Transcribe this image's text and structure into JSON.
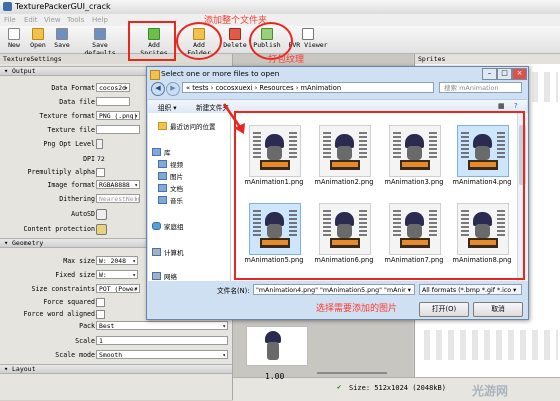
{
  "window": {
    "title": "TexturePackerGUI_crack"
  },
  "menu": [
    "File",
    "Edit",
    "View",
    "Tools",
    "Help"
  ],
  "toolbar": {
    "buttons": [
      "New",
      "Open",
      "Save",
      "Save defaults",
      "Add Sprites",
      "Add Folder",
      "Delete",
      "Publish",
      "PVR Viewer"
    ]
  },
  "settings": {
    "panel_title": "TextureSettings",
    "output_section": "Output",
    "data_format_label": "Data Format",
    "data_format_value": "cocos2d",
    "data_file_label": "Data file",
    "texture_format_label": "Texture format",
    "texture_format_value": "PNG (.png)",
    "texture_file_label": "Texture file",
    "png_opt_label": "Png Opt Level",
    "dpi_label": "DPI",
    "dpi_value": "72",
    "premultiply_label": "Premultiply alpha",
    "image_format_label": "Image format",
    "image_format_value": "RGBA8888",
    "dithering_label": "Dithering",
    "dithering_value": "NearestNeigh",
    "autosd_label": "AutoSD",
    "content_protection_label": "Content protection",
    "geometry_section": "Geometry",
    "max_size_label": "Max size",
    "max_size_value": "W: 2048",
    "fixed_size_label": "Fixed size",
    "fixed_size_value": "W:",
    "size_constraints_label": "Size constraints",
    "size_constraints_value": "POT (Power",
    "force_squared_label": "Force squared",
    "force_word_label": "Force word aligned",
    "pack_label": "Pack",
    "pack_value": "Best",
    "scale_label": "Scale",
    "scale_value": "1",
    "scale_mode_label": "Scale mode",
    "scale_mode_value": "Smooth",
    "layout_section": "Layout"
  },
  "sprites_panel": {
    "title": "Sprites"
  },
  "status": {
    "size": "Size: 512x1024 (2048kB)",
    "zoom": "1.00"
  },
  "dialog": {
    "title": "Select one or more files to open",
    "breadcrumb": "« tests › cocosxuexi › Resources › mAnimation",
    "search_placeholder": "搜索 mAnimation",
    "cmd_organize": "组织 ▾",
    "cmd_new_folder": "新建文件夹",
    "tree": [
      "最近访问的位置",
      "库",
      "视频",
      "图片",
      "文档",
      "音乐",
      "家庭组",
      "计算机",
      "网络"
    ],
    "files": [
      "mAnimation1.png",
      "mAnimation2.png",
      "mAnimation3.png",
      "mAnimation4.png",
      "mAnimation5.png",
      "mAnimation6.png",
      "mAnimation7.png",
      "mAnimation8.png"
    ],
    "filename_label": "文件名(N):",
    "filename_value": "\"mAnimation4.png\" \"mAnimation5.png\" \"mAnir ▾",
    "format_value": "All formats (*.bmp *.gif *.ico ▾",
    "open_button": "打开(O)",
    "cancel_button": "取消"
  },
  "annotations": {
    "add_folder_note": "添加整个文件夹",
    "publish_note": "打包纹理",
    "select_note": "选择需要添加的图片"
  },
  "colors": {
    "annotation_red": "#e8271f"
  }
}
